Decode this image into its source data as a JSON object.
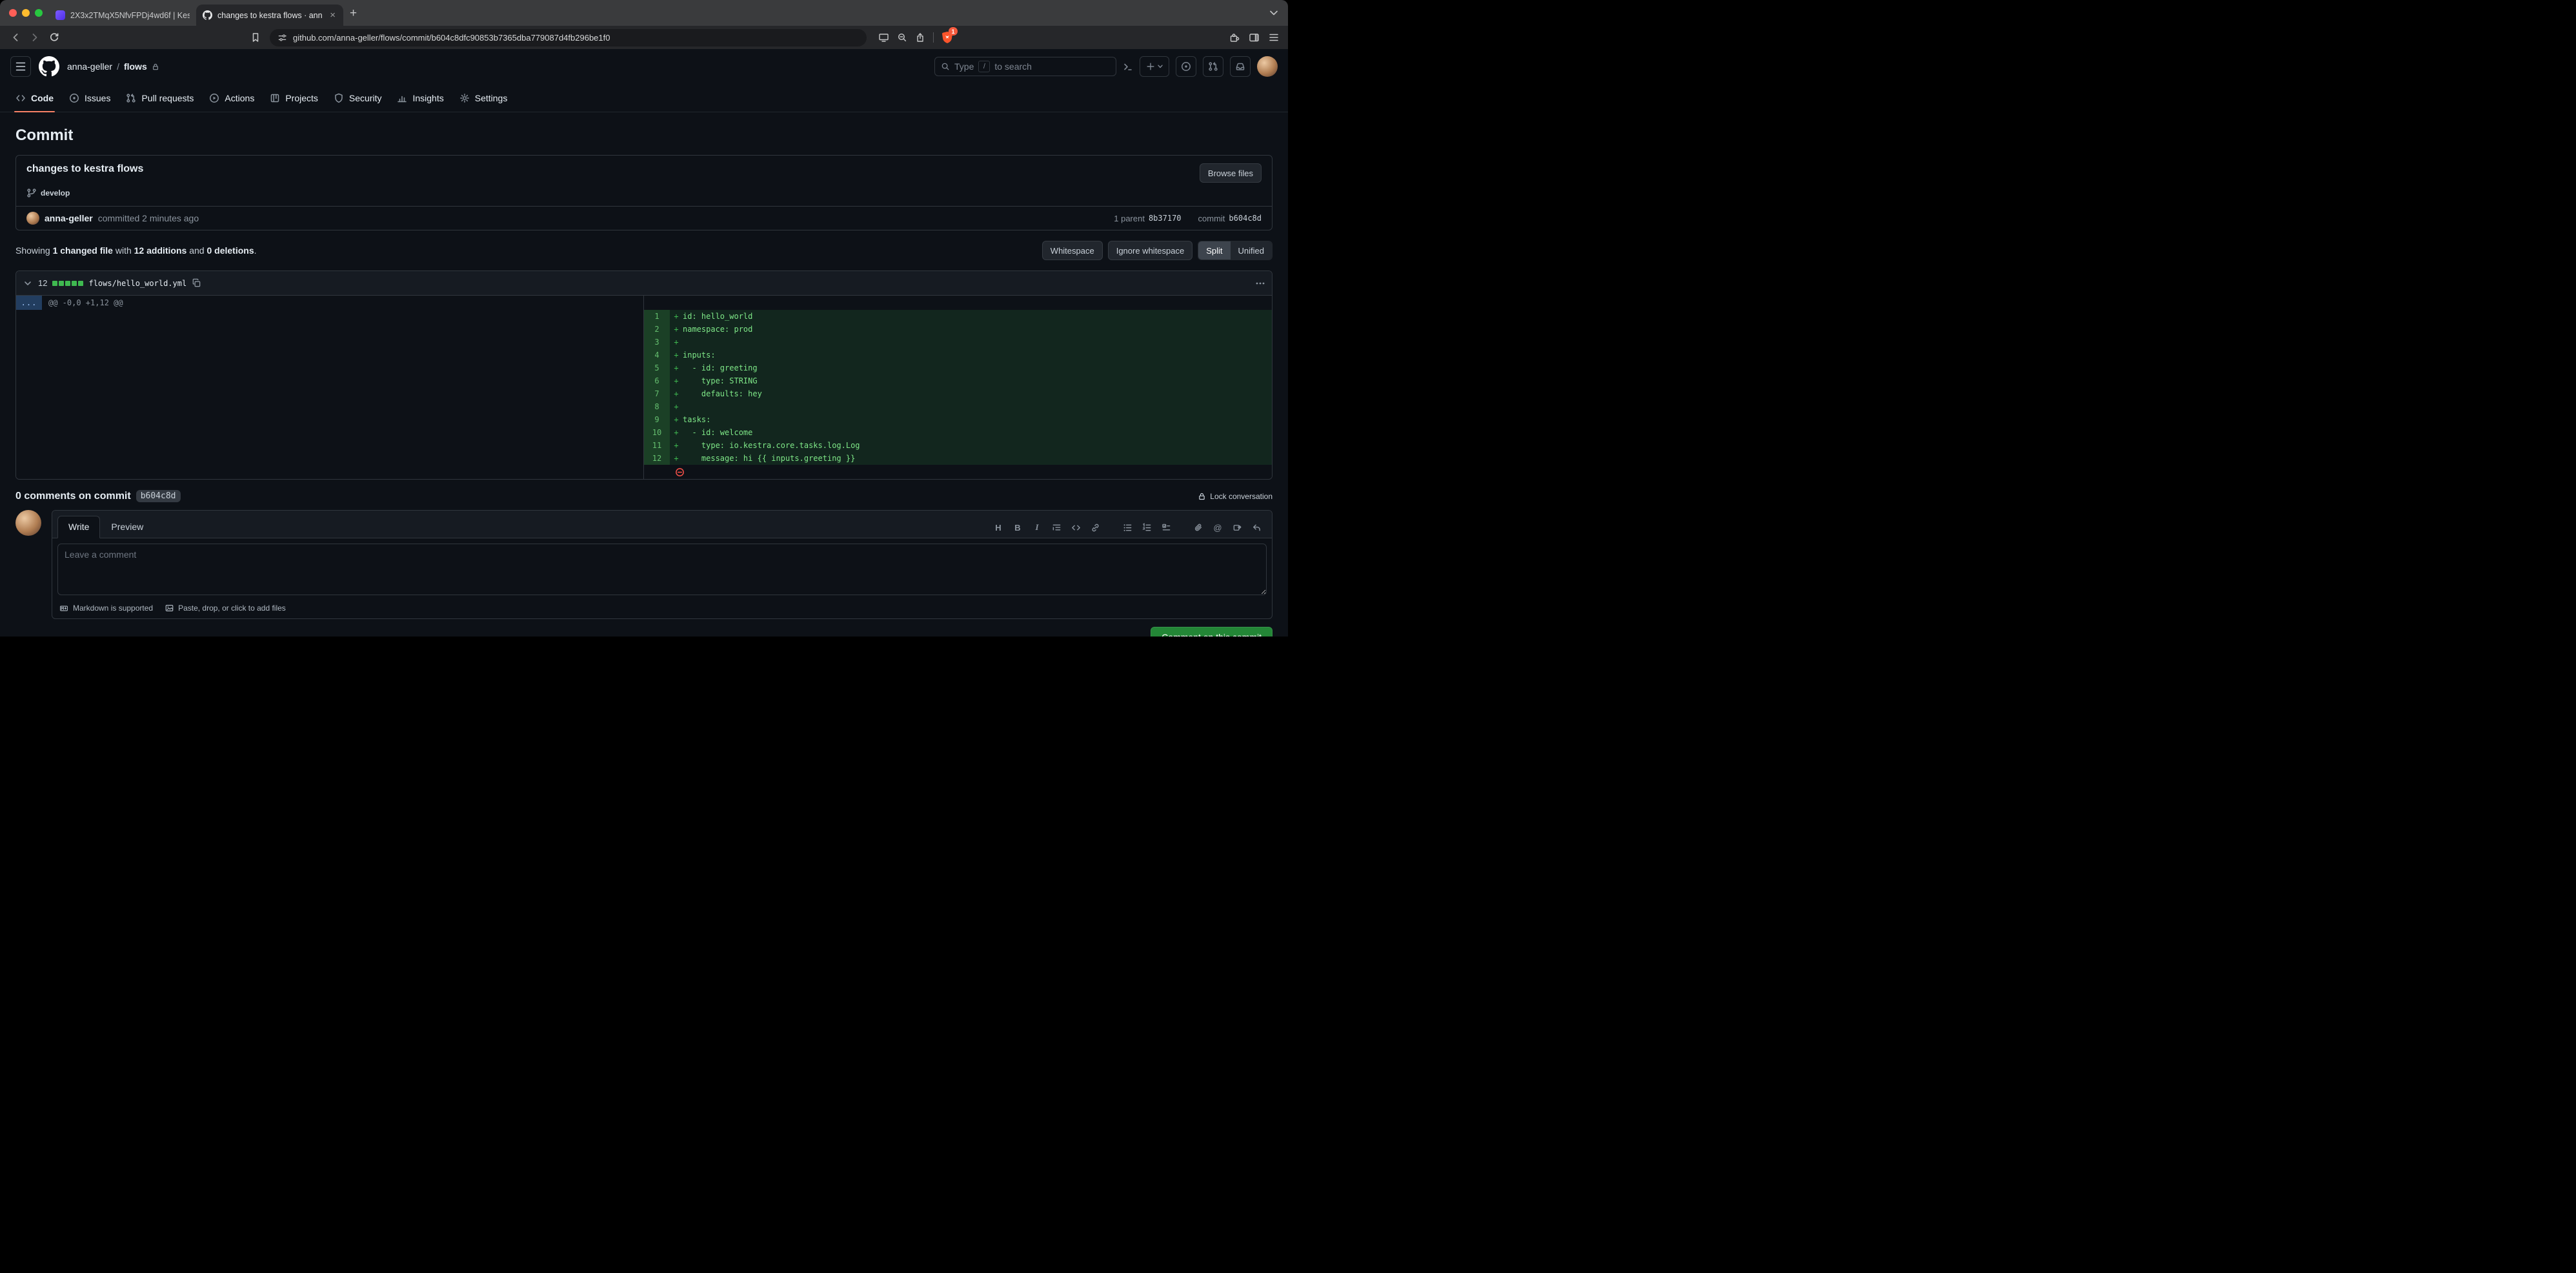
{
  "browser": {
    "tab_inactive": "2X3x2TMqX5NfvFPDj4wd6f | Kes",
    "tab_active": "changes to kestra flows · ann",
    "url": "github.com/anna-geller/flows/commit/b604c8dfc90853b7365dba779087d4fb296be1f0",
    "shield_badge": "1"
  },
  "header": {
    "owner": "anna-geller",
    "separator": "/",
    "repo": "flows",
    "search_pre": "Type",
    "search_key": "/",
    "search_post": "to search"
  },
  "nav": {
    "items": [
      {
        "label": "Code"
      },
      {
        "label": "Issues"
      },
      {
        "label": "Pull requests"
      },
      {
        "label": "Actions"
      },
      {
        "label": "Projects"
      },
      {
        "label": "Security"
      },
      {
        "label": "Insights"
      },
      {
        "label": "Settings"
      }
    ]
  },
  "page": {
    "title": "Commit"
  },
  "commit": {
    "message": "changes to kestra flows",
    "browse_files": "Browse files",
    "branch": "develop",
    "author": "anna-geller",
    "committed_text": "committed 2 minutes ago",
    "parent_label": "1 parent",
    "parent_sha": "8b37170",
    "commit_label": "commit",
    "commit_sha": "b604c8d"
  },
  "diff_toolbar": {
    "showing": "Showing",
    "changed_files": "1 changed file",
    "with_text": "with",
    "additions": "12 additions",
    "and_text": "and",
    "deletions": "0 deletions",
    "period": ".",
    "whitespace": "Whitespace",
    "ignore_whitespace": "Ignore whitespace",
    "split": "Split",
    "unified": "Unified"
  },
  "file": {
    "changes": "12",
    "name": "flows/hello_world.yml",
    "expander": "...",
    "hunk": "@@ -0,0 +1,12 @@",
    "marker": "+",
    "lines": [
      {
        "n": "1",
        "code": "id: hello_world"
      },
      {
        "n": "2",
        "code": "namespace: prod"
      },
      {
        "n": "3",
        "code": ""
      },
      {
        "n": "4",
        "code": "inputs:"
      },
      {
        "n": "5",
        "code": "  - id: greeting"
      },
      {
        "n": "6",
        "code": "    type: STRING"
      },
      {
        "n": "7",
        "code": "    defaults: hey"
      },
      {
        "n": "8",
        "code": ""
      },
      {
        "n": "9",
        "code": "tasks:"
      },
      {
        "n": "10",
        "code": "  - id: welcome"
      },
      {
        "n": "11",
        "code": "    type: io.kestra.core.tasks.log.Log"
      },
      {
        "n": "12",
        "code": "    message: hi {{ inputs.greeting }}"
      }
    ]
  },
  "comments": {
    "heading": "0 comments on commit",
    "sha": "b604c8d",
    "lock": "Lock conversation",
    "write_tab": "Write",
    "preview_tab": "Preview",
    "placeholder": "Leave a comment",
    "markdown_hint": "Markdown is supported",
    "attach_hint": "Paste, drop, or click to add files",
    "submit": "Comment on this commit"
  }
}
